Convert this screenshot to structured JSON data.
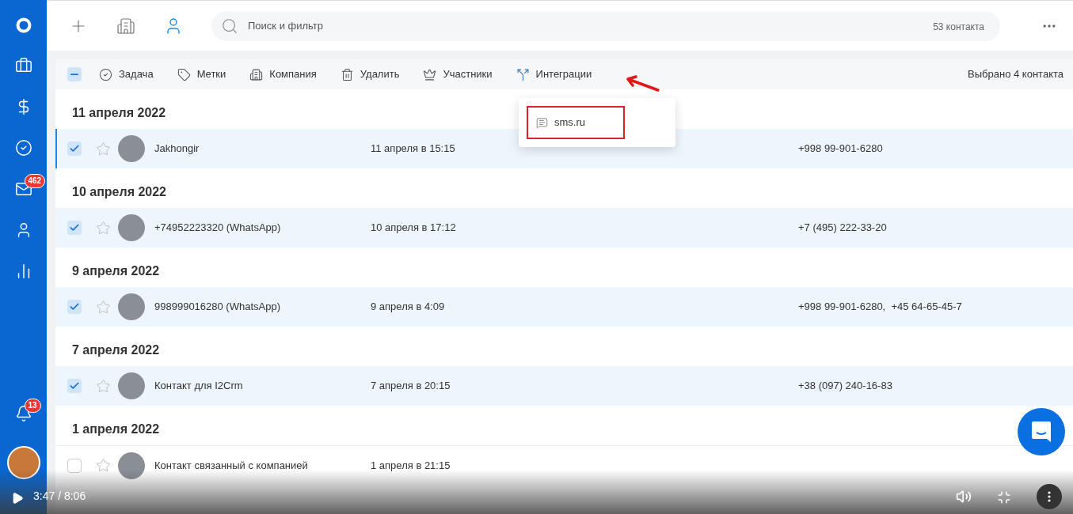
{
  "sidebar": {
    "mail_badge": "462",
    "notifications_badge": "13"
  },
  "top_bar": {
    "search": {
      "placeholder": "Поиск и фильтр"
    },
    "count": "53 контакта"
  },
  "toolbar": {
    "select_all": {
      "indeterminate": true
    },
    "actions": [
      {
        "kind": "task",
        "label": "Задача"
      },
      {
        "kind": "tags",
        "label": "Метки"
      },
      {
        "kind": "company",
        "label": "Компания"
      },
      {
        "kind": "delete",
        "label": "Удалить"
      },
      {
        "kind": "members",
        "label": "Участники"
      },
      {
        "kind": "integrations",
        "label": "Интеграции"
      }
    ],
    "selected_count": "Выбрано 4 контакта"
  },
  "menu": {
    "items": [
      {
        "label": "sms.ru"
      }
    ]
  },
  "groups": [
    {
      "date": "11 апреля 2022",
      "contacts": [
        {
          "name": "Jakhongir",
          "created": "11 апреля в 15:15",
          "phone": "+998 99-901-6280",
          "checked": true,
          "active": true
        }
      ]
    },
    {
      "date": "10 апреля 2022",
      "contacts": [
        {
          "name": "+74952223320 (WhatsApp)",
          "created": "10 апреля в 17:12",
          "phone": "+7 (495) 222-33-20",
          "checked": true,
          "active": false
        }
      ]
    },
    {
      "date": "9 апреля 2022",
      "contacts": [
        {
          "name": "998999016280 (WhatsApp)",
          "created": "9 апреля в 4:09",
          "phone": "+998 99-901-6280,  +45 64-65-45-7",
          "checked": true,
          "active": false
        }
      ]
    },
    {
      "date": "7 апреля 2022",
      "contacts": [
        {
          "name": "Контакт для I2Crm",
          "created": "7 апреля в 20:15",
          "phone": "+38 (097) 240-16-83",
          "checked": true,
          "active": false
        }
      ]
    },
    {
      "date": "1 апреля 2022",
      "contacts": [
        {
          "name": "Контакт связанный с компанией",
          "created": "1 апреля в 21:15",
          "checked": false,
          "active": false
        }
      ]
    }
  ],
  "video": {
    "time": "3:47 / 8:06"
  }
}
